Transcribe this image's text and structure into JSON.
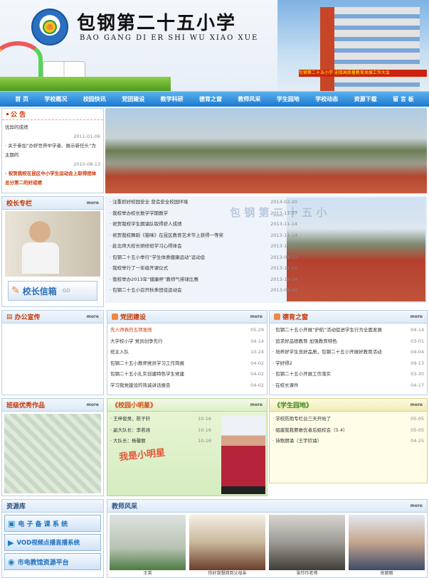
{
  "header": {
    "title": "包钢第二十五小学",
    "subtitle": "BAO GANG DI ER SHI WU XIAO XUE",
    "banner": "包钢第二十五小学 迎接高质量教育发展工作大会"
  },
  "nav": [
    "首  页",
    "学校概况",
    "校园快讯",
    "党团建设",
    "教学科研",
    "德育之窗",
    "教师风采",
    "学生园地",
    "学校动态",
    "资源下载",
    "留 言 板"
  ],
  "notice": {
    "title": "公  告",
    "items": [
      {
        "text": "优异的成绩",
        "date": "2011-01-06"
      },
      {
        "text": "· 关于参加“办好世界中学者、展示新任头”为主题的",
        "date": "2010-08-13"
      },
      {
        "text": "· 祝贺我校在昆区中小学生运动会上取得团体总分第二的好成绩",
        "date": ""
      }
    ]
  },
  "news": {
    "items": [
      {
        "text": "· 注重抓好校园安全 营造安全校园环境",
        "date": "2014-02-20"
      },
      {
        "text": "· 我校举办校长数学学期教学",
        "date": "2013-11-27"
      },
      {
        "text": "· 祝贺我校学生朗诵队取得骄人成绩",
        "date": "2013-11-14"
      },
      {
        "text": "· 祝贺我校舞蹈《猫咪》在昆区教育艺术节上获得一等奖",
        "date": "2013-11-14"
      },
      {
        "text": "· 赴北师大校长研修班学习心得体会",
        "date": "2013-11-04"
      },
      {
        "text": "· 包钢二十五小举行“学生体质健康运动”运动会",
        "date": "2013-09-17"
      },
      {
        "text": "· 我校举行了一年级开课仪式",
        "date": "2013-11-01"
      },
      {
        "text": "· 我校举办2013年“健康杯”教师气排球比赛",
        "date": "2013-10-24"
      },
      {
        "text": "· 包钢二十五小召开秋季田径运动会",
        "date": "2013-09-29"
      }
    ],
    "photo_caption": "包 钢 第 二 十 五 小"
  },
  "principal": {
    "title": "校长专栏",
    "more": "more",
    "mailbox": "校长信箱",
    "mailbox_go": "GO"
  },
  "office": {
    "title": "办公宣传",
    "more": "more"
  },
  "party": {
    "title": "党团建设",
    "more": "more",
    "items": [
      {
        "text": "先人师表的五项准则",
        "date": "05-29"
      },
      {
        "text": "大学校小学 党员创争先行",
        "date": "04-14"
      },
      {
        "text": "班主入队",
        "date": "10-24"
      },
      {
        "text": "包钢二十五小教师党员学习工作简报",
        "date": "04-02"
      },
      {
        "text": "包钢二十五小扎实创建特色学生党建",
        "date": "04-02"
      },
      {
        "text": "学习我党建设的热诚讲话报告",
        "date": "04-02"
      }
    ]
  },
  "moral": {
    "title": "德育之窗",
    "more": "more",
    "items": [
      {
        "text": "· 包钢二十五小开展“护航”活动促进学生行为全面发展",
        "date": "04-14"
      },
      {
        "text": "· 追求好品德教育 加强教育特色",
        "date": "03-01"
      },
      {
        "text": "· 培养好学生良好品质，包钢二十五小开展好教育活动",
        "date": "04-04"
      },
      {
        "text": "· 学好得2",
        "date": "09-13"
      },
      {
        "text": "· 包钢二十五小开展工作落实",
        "date": "03-30"
      },
      {
        "text": "· 在校长课件",
        "date": "04-17"
      }
    ]
  },
  "class_works": {
    "title": "班级优秀作品",
    "more": "more"
  },
  "campus_star": {
    "title": "《校园小明星》",
    "more": "more",
    "items": [
      {
        "text": "· 王梓俊吴、陈子轩",
        "date": "10-16"
      },
      {
        "text": "· 副大队长：李若涵",
        "date": "10-16"
      },
      {
        "text": "· 大队长：杨馨丽",
        "date": "10-16"
      }
    ],
    "photo_caption": "我是小明星"
  },
  "student_garden": {
    "title": "《学生园地》",
    "more": "more",
    "items": [
      {
        "text": "· 学校防雨专栏台三天开始了",
        "date": "05-05"
      },
      {
        "text": "· 组建我我要敢优者后姐校会（5.4）",
        "date": "05-05"
      },
      {
        "text": "· 诗歌朗诵（王宇欣诵）",
        "date": "04-25"
      }
    ]
  },
  "resources": {
    "title": "资源库",
    "items": [
      "电 子 备 课 系 统",
      "VOD视频点播直播系统",
      "市电教馆资源平台"
    ]
  },
  "teachers": {
    "title": "教师风采",
    "more": "more",
    "captions": [
      "王英",
      "你好我想回到父母亲",
      "张玲玲老师",
      "岳丽丽"
    ]
  }
}
